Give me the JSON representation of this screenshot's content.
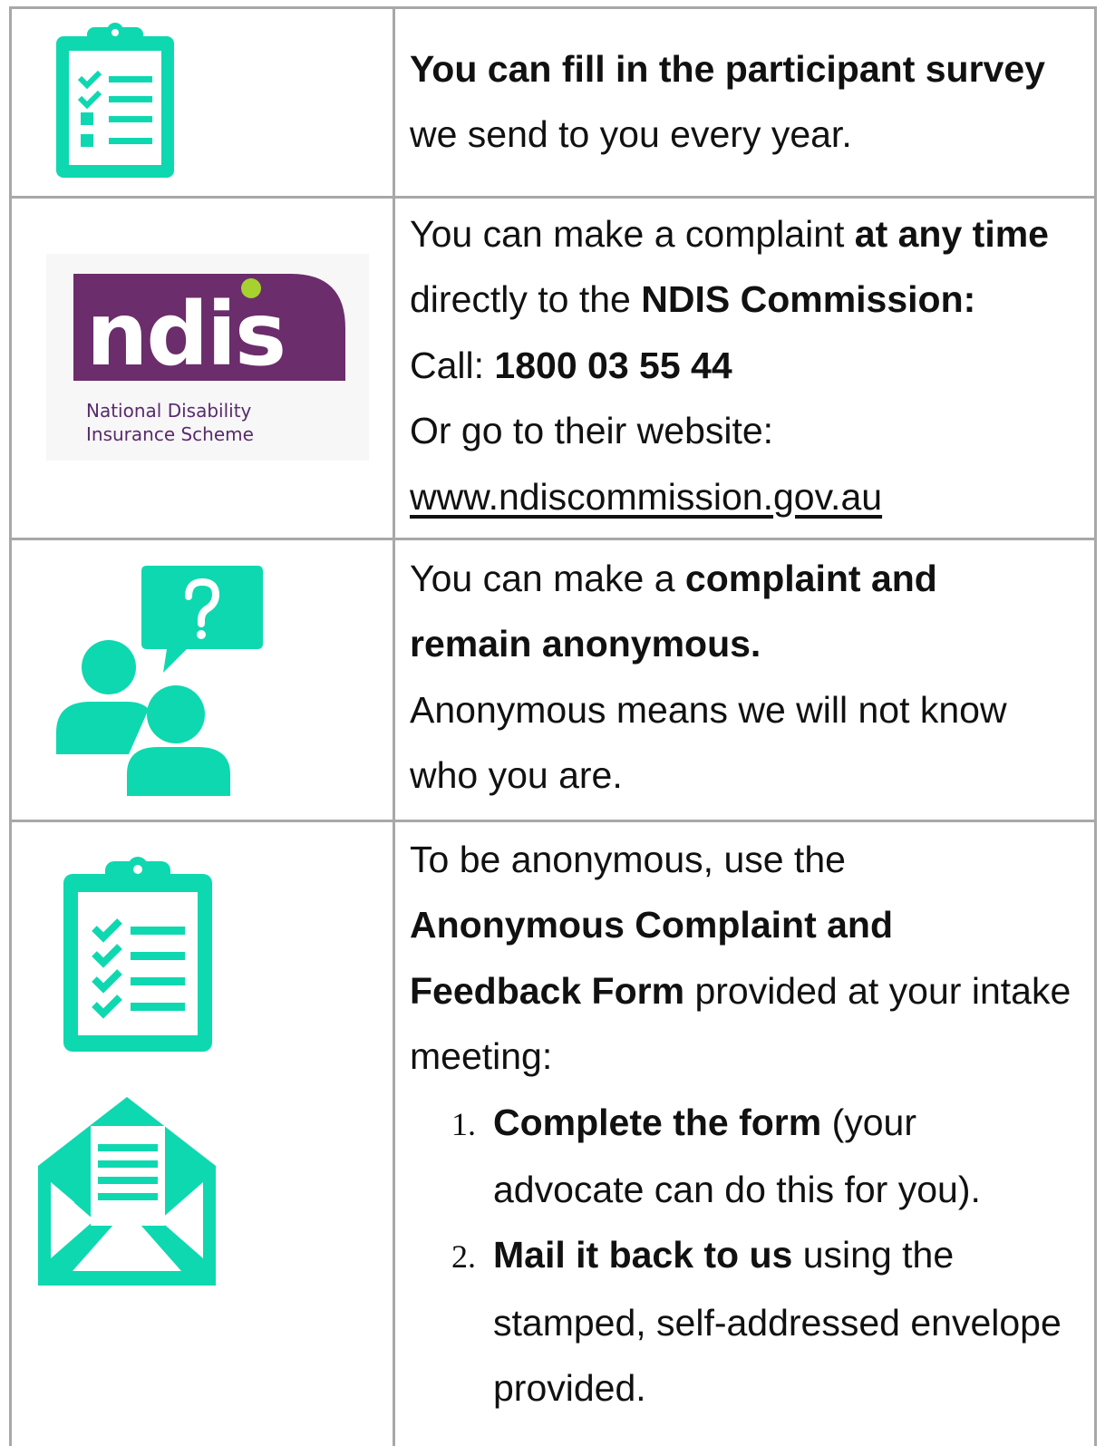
{
  "colors": {
    "icon": "#0ed8b0",
    "ndis_purple": "#6b2d6b",
    "ndis_dot": "#a6d12e",
    "border": "#a8a8a8"
  },
  "row1": {
    "icon": "clipboard-checklist-icon",
    "line1": "You can fill in the participant survey",
    "line2": "we send to you every year."
  },
  "row2": {
    "logo_word": "ndis",
    "logo_caption_1": "National Disability",
    "logo_caption_2": "Insurance Scheme",
    "line1_a": "You can make a complaint ",
    "line1_b": "at any time",
    "line2_a": "directly to the ",
    "line2_b": "NDIS Commission:",
    "line3_a": "Call: ",
    "line3_b": "1800 03 55 44",
    "line4": "Or go to their website:",
    "website": "www.ndiscommission.gov.au"
  },
  "row3": {
    "icon": "people-question-icon",
    "line1_a": "You can make a ",
    "line1_b": "complaint and",
    "line2": "remain anonymous.",
    "line3": "Anonymous means we will not know",
    "line4": "who you are."
  },
  "row4": {
    "icon_top": "clipboard-checklist-icon",
    "icon_bottom": "envelope-letter-icon",
    "line1": "To be anonymous, use the",
    "line2": "Anonymous Complaint and",
    "line3_a": "Feedback Form",
    "line3_b": " provided at your intake",
    "line4": "meeting:",
    "step1_num": "1.",
    "step1_a": "Complete the form",
    "step1_b": " (your",
    "step1_c": "advocate can do this for you).",
    "step2_num": "2.",
    "step2_a": "Mail it back to us",
    "step2_b": " using the",
    "step2_c": "stamped, self-addressed envelope",
    "step2_d": "provided."
  }
}
